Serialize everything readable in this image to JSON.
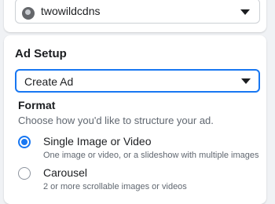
{
  "account": {
    "name": "twowildcdns"
  },
  "ad_setup": {
    "title": "Ad Setup",
    "ad_select_value": "Create Ad",
    "format_label": "Format",
    "format_help": "Choose how you'd like to structure your ad.",
    "options": [
      {
        "title": "Single Image or Video",
        "description": "One image or video, or a slideshow with multiple images",
        "selected": true
      },
      {
        "title": "Carousel",
        "description": "2 or more scrollable images or videos",
        "selected": false
      }
    ]
  },
  "colors": {
    "accent": "#1877f2",
    "background": "#f0f2f5",
    "text_secondary": "#606770"
  }
}
